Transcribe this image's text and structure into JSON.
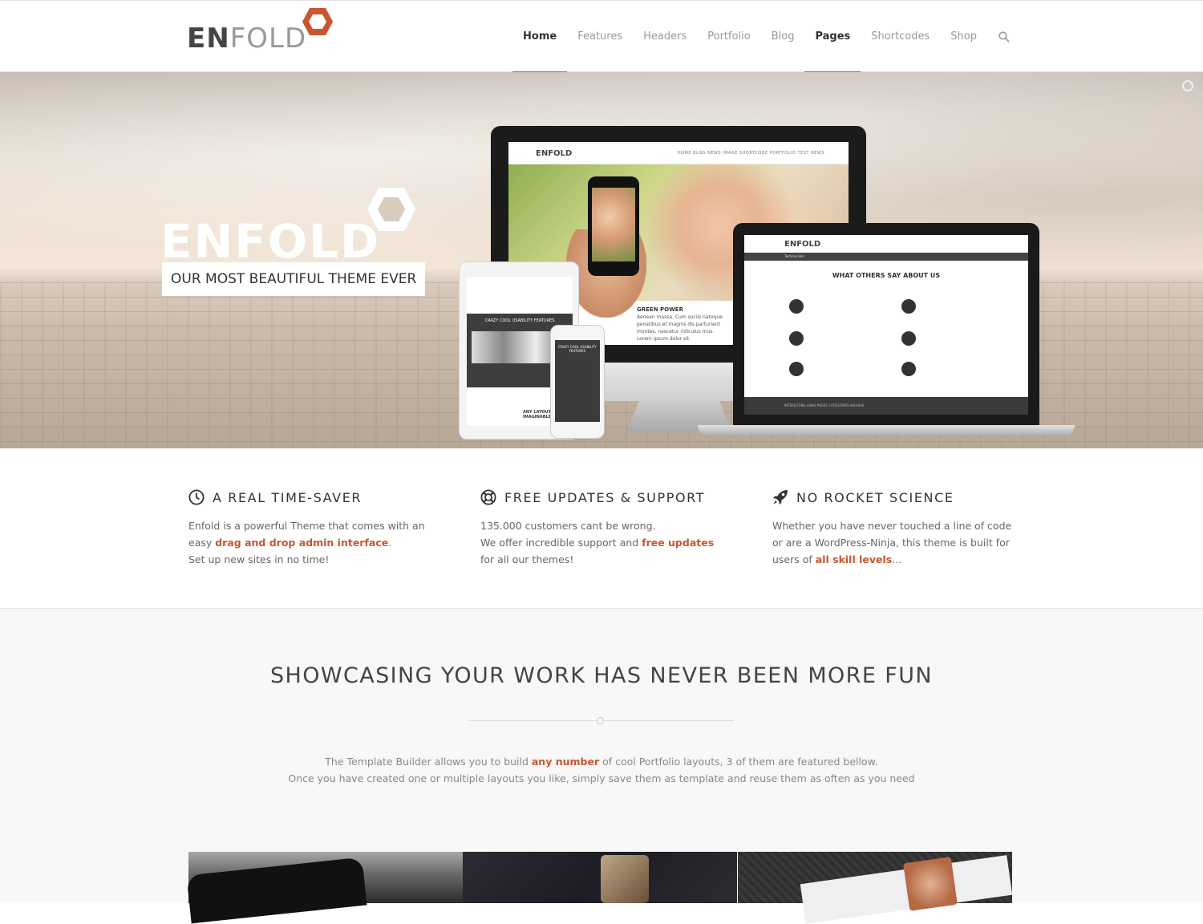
{
  "header": {
    "logo": {
      "part1": "EN",
      "part2": "FOLD"
    },
    "nav": [
      {
        "label": "Home",
        "active": true
      },
      {
        "label": "Features",
        "active": false
      },
      {
        "label": "Headers",
        "active": false
      },
      {
        "label": "Portfolio",
        "active": false
      },
      {
        "label": "Blog",
        "active": false
      },
      {
        "label": "Pages",
        "active": true
      },
      {
        "label": "Shortcodes",
        "active": false
      },
      {
        "label": "Shop",
        "active": false
      }
    ],
    "search_icon": "search-icon"
  },
  "hero": {
    "logo_text": "ENFOLD",
    "tagline": "OUR MOST BEAUTIFUL THEME EVER",
    "imac": {
      "logo": "ENFOLD",
      "nav": "HOME   BLOG   NEWS   IMAGE SHORTCODE   PORTFOLIO   TEST   NEWS",
      "heading": "GREEN POWER",
      "text": "Aenean massa. Cum sociis natoque penatibus et magnis dis parturient montes, nascetur ridiculus mus. Lorem ipsum dolor sit."
    },
    "macbook": {
      "logo": "ENFOLD",
      "bar": "Testimonials",
      "title": "WHAT OTHERS SAY ABOUT US",
      "footer": "INTERESTING LINKS   PAGES   CATEGORIES   ARCHIVE"
    },
    "ipad": {
      "section": "CRAZY COOL USABILITY FEATURES",
      "footer": "ANY LAYOUT IMAGINABLE"
    },
    "iphone": {
      "section": "CRAZY COOL USABILITY FEATURES"
    }
  },
  "features": [
    {
      "icon": "clock-icon",
      "title": "A REAL TIME-SAVER",
      "line1_pre": "Enfold is a powerful Theme that comes with an easy ",
      "line1_link": "drag and drop admin interface",
      "line1_post": ".",
      "line2": "Set up new sites in no time!"
    },
    {
      "icon": "lifebuoy-icon",
      "title": "FREE UPDATES & SUPPORT",
      "line1": "135.000 customers cant be wrong.",
      "line2_pre": "We offer incredible support and ",
      "line2_link": "free updates",
      "line2_post": " for all our themes!"
    },
    {
      "icon": "rocket-icon",
      "title": "NO ROCKET SCIENCE",
      "line1_pre": "Whether you have never touched a line of code or are a WordPress-Ninja, this theme is built for users of ",
      "line1_link": "all skill levels",
      "line1_post": "..."
    }
  ],
  "showcase": {
    "heading": "SHOWCASING YOUR WORK HAS NEVER BEEN MORE FUN",
    "p1_pre": "The Template Builder allows you to build ",
    "p1_link": "any number",
    "p1_post": " of cool Portfolio layouts, 3 of them are featured bellow.",
    "p2": "Once you have created one or multiple layouts you like, simply save them as template and reuse them as often as you need"
  },
  "colors": {
    "accent": "#c8562e",
    "text": "#666666",
    "heading": "#333333"
  }
}
